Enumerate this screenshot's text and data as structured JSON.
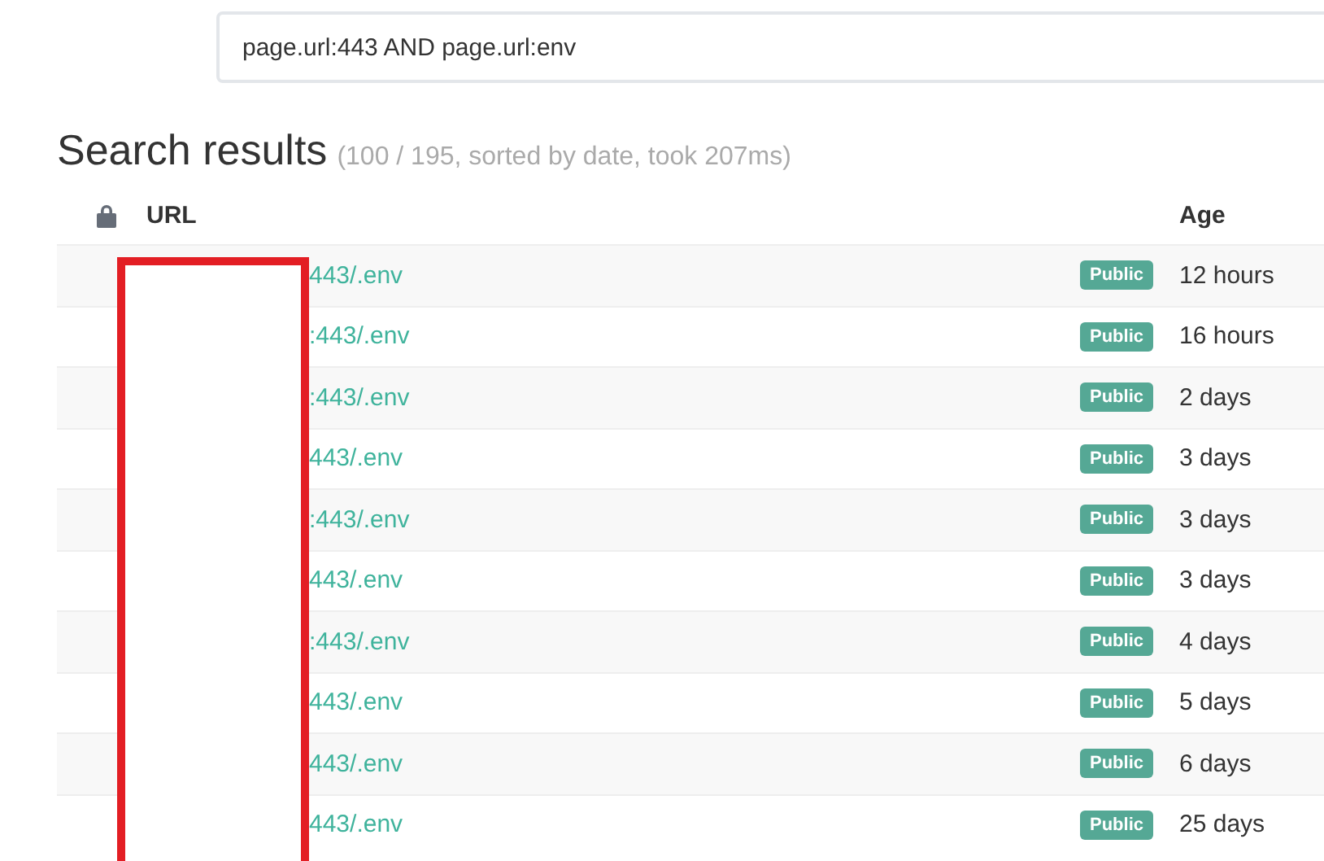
{
  "search": {
    "value": "page.url:443 AND page.url:env"
  },
  "heading": {
    "title": "Search results",
    "summary": "(100 / 195, sorted by date, took 207ms)"
  },
  "table": {
    "columns": [
      "URL",
      "Age"
    ],
    "rows": [
      {
        "url": "443/.env",
        "badge": "Public",
        "age": "12 hours"
      },
      {
        "url": ":443/.env",
        "badge": "Public",
        "age": "16 hours"
      },
      {
        "url": ":443/.env",
        "badge": "Public",
        "age": "2 days"
      },
      {
        "url": "443/.env",
        "badge": "Public",
        "age": "3 days"
      },
      {
        "url": ":443/.env",
        "badge": "Public",
        "age": "3 days"
      },
      {
        "url": "443/.env",
        "badge": "Public",
        "age": "3 days"
      },
      {
        "url": ":443/.env",
        "badge": "Public",
        "age": "4 days"
      },
      {
        "url": "443/.env",
        "badge": "Public",
        "age": "5 days"
      },
      {
        "url": "443/.env",
        "badge": "Public",
        "age": "6 days"
      },
      {
        "url": "443/.env",
        "badge": "Public",
        "age": "25 days"
      }
    ]
  }
}
